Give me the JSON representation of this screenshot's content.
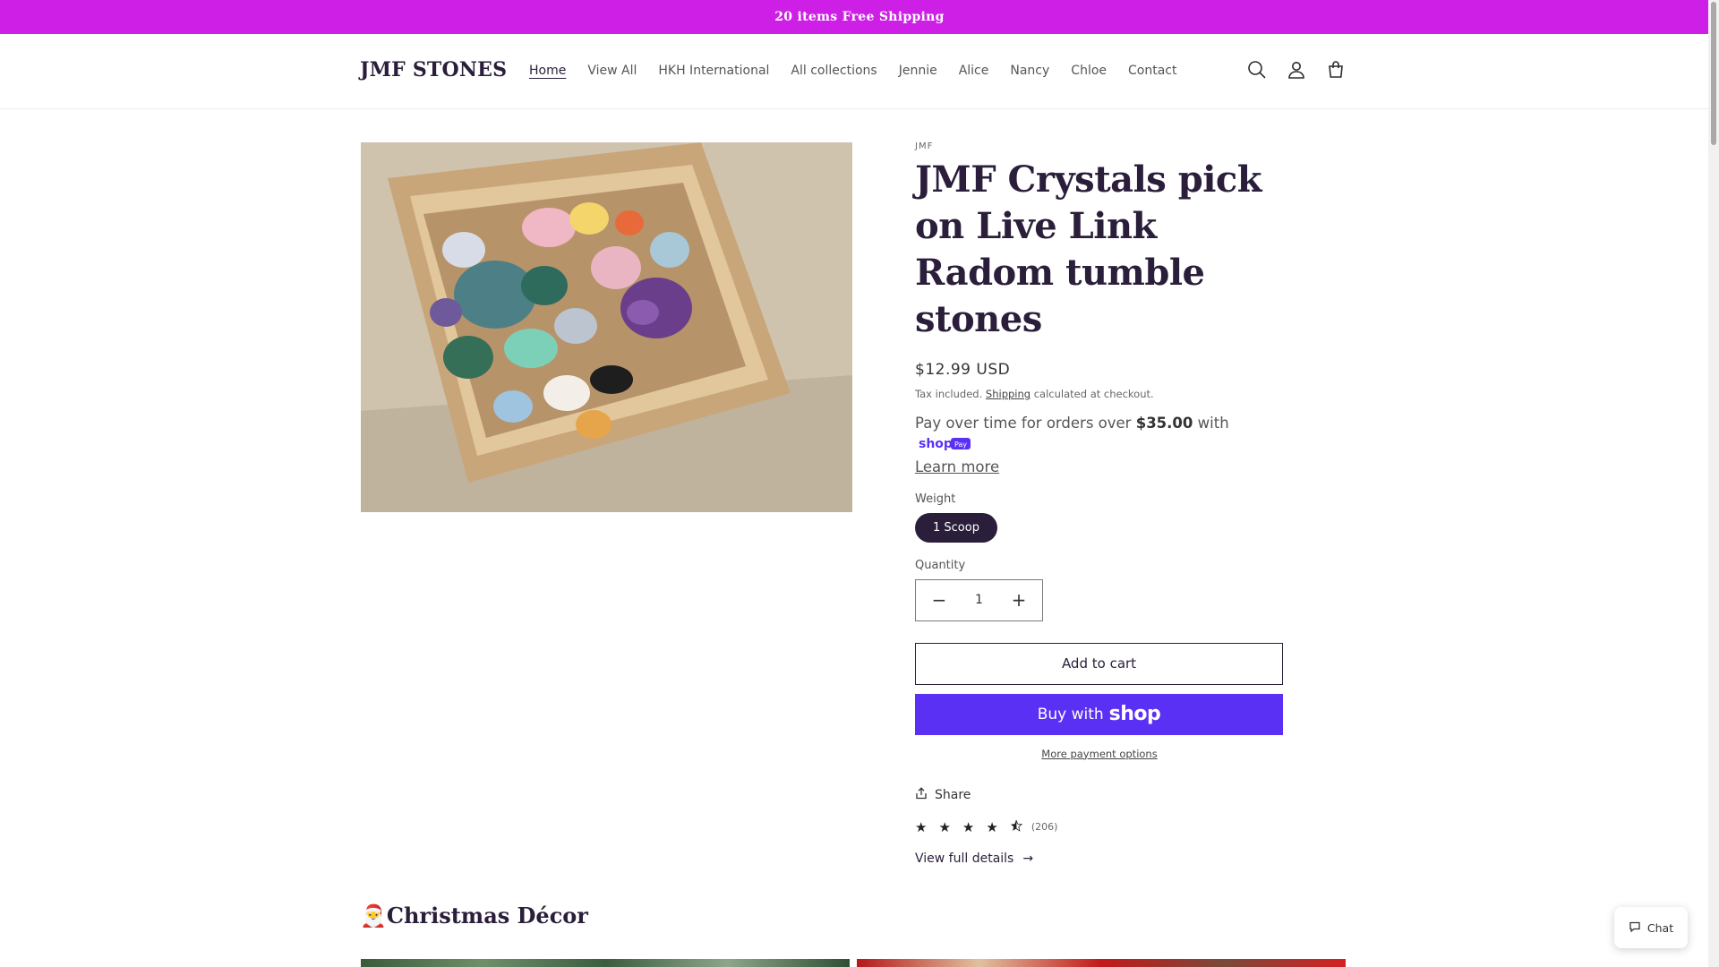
{
  "announcement": {
    "text": "20 items Free Shipping"
  },
  "header": {
    "logo": "JMF STONES",
    "nav": [
      "Home",
      "View All",
      "HKH International",
      "All collections",
      "Jennie",
      "Alice",
      "Nancy",
      "Chloe",
      "Contact"
    ],
    "active_nav": "Home",
    "icons": [
      "search-icon",
      "account-icon",
      "cart-icon"
    ]
  },
  "product": {
    "vendor": "JMF",
    "title": "JMF Crystals pick on Live Link Radom tumble stones",
    "price": "$12.99 USD",
    "tax_prefix": "Tax included.",
    "tax_link": "Shipping",
    "tax_suffix": "calculated at checkout.",
    "installments_prefix": "Pay over time for orders over",
    "installments_amount": "$35.00",
    "installments_with": "with",
    "shop_pay_brand": "shop",
    "shop_pay_badge": "Pay",
    "learn_more": "Learn more",
    "weight_label": "Weight",
    "weight_option": "1 Scoop",
    "quantity_label": "Quantity",
    "quantity_value": "1",
    "quantity_decrease": "−",
    "quantity_increase": "+",
    "add_to_cart": "Add to cart",
    "buy_with": "Buy with",
    "buy_brand": "shop",
    "more_payment": "More payment options",
    "share": "Share",
    "rating_value": 4.5,
    "rating_max": 5,
    "review_count": "(206)",
    "view_details": "View full details",
    "view_details_arrow": "→"
  },
  "collection": {
    "title": "🎅Christmas Décor"
  },
  "chat": {
    "label": "Chat"
  },
  "colors": {
    "announcement_bg": "#cd1fe6",
    "brand_dark": "#2a1e3a",
    "shop_pay": "#5a31f4"
  }
}
